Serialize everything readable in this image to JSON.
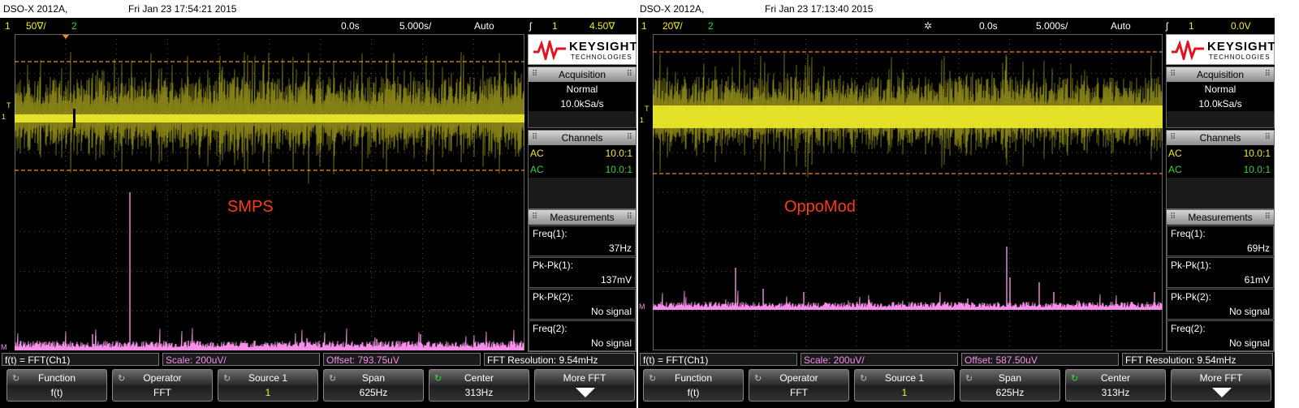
{
  "scopes": [
    {
      "model": "DSO-X 2012A,",
      "datetime": "Fri Jan 23 17:54:21 2015",
      "status": {
        "ch1_num": "1",
        "ch1_scale": "50∇/",
        "ch2_num": "2",
        "delay": "0.0s",
        "timebase": "5.000s/",
        "mode": "Auto",
        "trig_icon": "ʃ",
        "trig_ch": "1",
        "trig_level": "4.50∇"
      },
      "label": "SMPS",
      "logo": {
        "brand": "KEYSIGHT",
        "sub": "TECHNOLOGIES"
      },
      "acquisition": {
        "title": "Acquisition",
        "mode": "Normal",
        "rate": "10.0kSa/s"
      },
      "channels": {
        "title": "Channels",
        "rows": [
          {
            "coupling": "AC",
            "probe": "10.0:1"
          },
          {
            "coupling": "AC",
            "probe": "10.0:1"
          }
        ]
      },
      "measurements": {
        "title": "Measurements",
        "items": [
          {
            "name": "Freq(1):",
            "value": "37Hz"
          },
          {
            "name": "Pk-Pk(1):",
            "value": "137mV"
          },
          {
            "name": "Pk-Pk(2):",
            "value": "No signal"
          },
          {
            "name": "Freq(2):",
            "value": "No signal"
          }
        ]
      },
      "fft": {
        "func": "f(t) = FFT(Ch1)",
        "scale": "Scale: 200uV/",
        "offset": "Offset: 793.75uV",
        "resolution": "FFT Resolution: 9.54mHz"
      },
      "softkeys": [
        {
          "title": "Function",
          "value": "f(t)"
        },
        {
          "title": "Operator",
          "value": "FFT"
        },
        {
          "title": "Source 1",
          "value": "1"
        },
        {
          "title": "Span",
          "value": "625Hz"
        },
        {
          "title": "Center",
          "value": "313Hz"
        },
        {
          "title": "More FFT",
          "value": ""
        }
      ],
      "marker_T": "T",
      "marker_1": "1",
      "marker_M": "M"
    },
    {
      "model": "DSO-X 2012A,",
      "datetime": "Fri Jan 23 17:13:40 2015",
      "status": {
        "ch1_num": "1",
        "ch1_scale": "20∇/",
        "ch2_num": "2",
        "delay": "0.0s",
        "timebase": "5.000s/",
        "mode": "Auto",
        "trig_icon": "ʃ",
        "trig_ch": "1",
        "trig_level": "0.0V"
      },
      "label": "OppoMod",
      "logo": {
        "brand": "KEYSIGHT",
        "sub": "TECHNOLOGIES"
      },
      "acquisition": {
        "title": "Acquisition",
        "mode": "Normal",
        "rate": "10.0kSa/s"
      },
      "channels": {
        "title": "Channels",
        "rows": [
          {
            "coupling": "AC",
            "probe": "10.0:1"
          },
          {
            "coupling": "AC",
            "probe": "10.0:1"
          }
        ]
      },
      "measurements": {
        "title": "Measurements",
        "items": [
          {
            "name": "Freq(1):",
            "value": "69Hz"
          },
          {
            "name": "Pk-Pk(1):",
            "value": "61mV"
          },
          {
            "name": "Pk-Pk(2):",
            "value": "No signal"
          },
          {
            "name": "Freq(2):",
            "value": "No signal"
          }
        ]
      },
      "fft": {
        "func": "f(t) = FFT(Ch1)",
        "scale": "Scale: 200uV/",
        "offset": "Offset: 587.50uV",
        "resolution": "FFT Resolution: 9.54mHz"
      },
      "softkeys": [
        {
          "title": "Function",
          "value": "f(t)"
        },
        {
          "title": "Operator",
          "value": "FFT"
        },
        {
          "title": "Source 1",
          "value": "1"
        },
        {
          "title": "Span",
          "value": "625Hz"
        },
        {
          "title": "Center",
          "value": "313Hz"
        },
        {
          "title": "More FFT",
          "value": ""
        }
      ],
      "marker_T": "T",
      "marker_1": "1",
      "marker_M": "M"
    }
  ],
  "colors": {
    "ch1": "#f0ea2a",
    "ch2": "#3cd13c",
    "math": "#f58fe8",
    "label": "#ff3a1a",
    "cursor": "#f08a1c"
  }
}
